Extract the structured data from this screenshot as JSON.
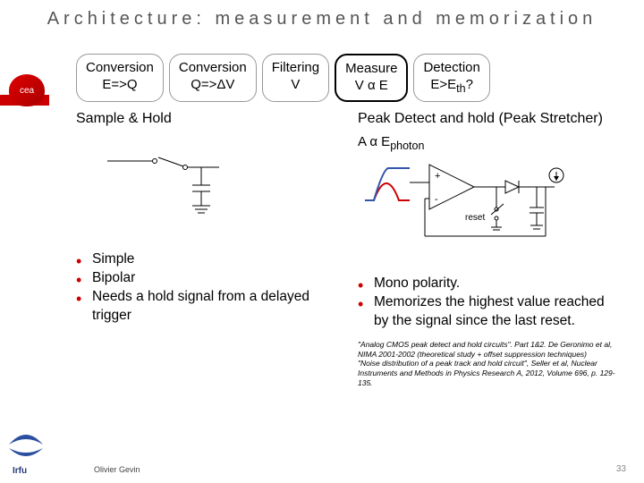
{
  "title": "Architecture: measurement and memorization",
  "pipeline": [
    {
      "label": "Conversion",
      "sub": "E=>Q",
      "selected": false
    },
    {
      "label": "Conversion",
      "sub": "Q=>ΔV",
      "selected": false
    },
    {
      "label": "Filtering",
      "sub": "V",
      "selected": false
    },
    {
      "label": "Measure",
      "sub": "V α E",
      "selected": true
    },
    {
      "label": "Detection",
      "sub_html": "E>E<sub>th</sub>?",
      "selected": false
    }
  ],
  "left": {
    "heading": "Sample & Hold",
    "bullets": [
      "Simple",
      "Bipolar",
      "Needs a hold signal from a delayed trigger"
    ]
  },
  "right": {
    "heading": "Peak Detect and hold (Peak Stretcher)",
    "formula_html": "A α E<sub>photon</sub>",
    "bullets": [
      "Mono polarity.",
      "Memorizes the highest value reached by the signal since the last reset."
    ],
    "refs": [
      "\"Analog CMOS peak detect and hold circuits\". Part 1&2. De Geronimo et al, NIMA 2001-2002 (theoretical study + offset suppression techniques)",
      "\"Noise distribution of a peak track and hold circuit\", Seller et al, Nuclear Instruments and Methods in Physics Research A, 2012, Volume 696, p. 129-135."
    ]
  },
  "footer": "Olivier Gevin",
  "page": "33",
  "logo_cea": "cea",
  "logo_irfu": "Irfu"
}
